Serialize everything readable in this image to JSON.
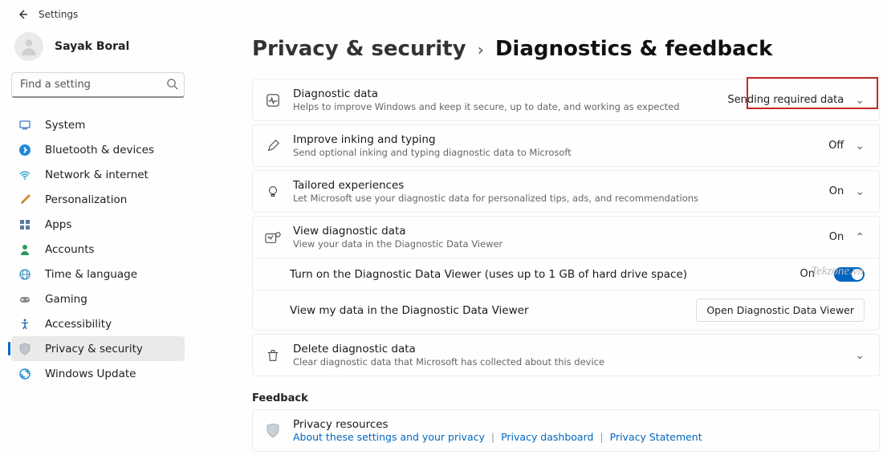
{
  "top": {
    "title": "Settings"
  },
  "user": {
    "name": "Sayak Boral"
  },
  "search": {
    "placeholder": "Find a setting"
  },
  "sidebar": {
    "items": [
      {
        "id": "system",
        "label": "System",
        "active": false
      },
      {
        "id": "bluetooth",
        "label": "Bluetooth & devices",
        "active": false
      },
      {
        "id": "network",
        "label": "Network & internet",
        "active": false
      },
      {
        "id": "personalize",
        "label": "Personalization",
        "active": false
      },
      {
        "id": "apps",
        "label": "Apps",
        "active": false
      },
      {
        "id": "accounts",
        "label": "Accounts",
        "active": false
      },
      {
        "id": "time",
        "label": "Time & language",
        "active": false
      },
      {
        "id": "gaming",
        "label": "Gaming",
        "active": false
      },
      {
        "id": "accessibility",
        "label": "Accessibility",
        "active": false
      },
      {
        "id": "privacy",
        "label": "Privacy & security",
        "active": true
      },
      {
        "id": "update",
        "label": "Windows Update",
        "active": false
      }
    ]
  },
  "breadcrumb": {
    "parent": "Privacy & security",
    "current": "Diagnostics & feedback"
  },
  "cards": {
    "diag_data": {
      "title": "Diagnostic data",
      "sub": "Helps to improve Windows and keep it secure, up to date, and working as expected",
      "value": "Sending required data"
    },
    "inking": {
      "title": "Improve inking and typing",
      "sub": "Send optional inking and typing diagnostic data to Microsoft",
      "value": "Off"
    },
    "tailored": {
      "title": "Tailored experiences",
      "sub": "Let Microsoft use your diagnostic data for personalized tips, ads, and recommendations",
      "value": "On"
    },
    "view_diag": {
      "title": "View diagnostic data",
      "sub": "View your data in the Diagnostic Data Viewer",
      "value": "On"
    },
    "viewer_tog": {
      "label": "Turn on the Diagnostic Data Viewer (uses up to 1 GB of hard drive space)",
      "value": "On"
    },
    "viewer_open": {
      "label": "View my data in the Diagnostic Data Viewer",
      "button": "Open Diagnostic Data Viewer"
    },
    "delete": {
      "title": "Delete diagnostic data",
      "sub": "Clear diagnostic data that Microsoft has collected about this device"
    }
  },
  "feedback_heading": "Feedback",
  "privacy_resources": {
    "title": "Privacy resources",
    "links": [
      "About these settings and your privacy",
      "Privacy dashboard",
      "Privacy Statement"
    ]
  },
  "watermark": "Tekzone.vn"
}
